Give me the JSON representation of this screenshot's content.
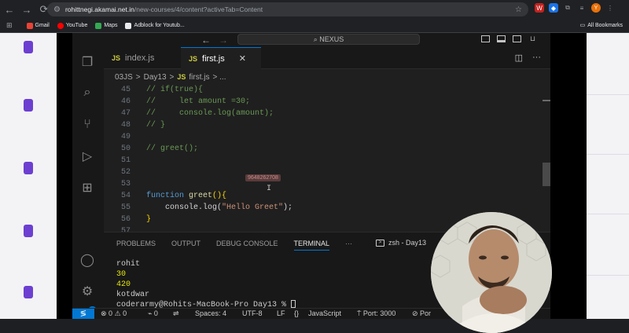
{
  "browser": {
    "url_host": "rohittnegi.akamai.net.in",
    "url_path": "/new-courses/4/content?activeTab=Content",
    "bookmarks": [
      "Gmail",
      "YouTube",
      "Maps",
      "Adblock for Youtub..."
    ],
    "all_bookmarks": "All Bookmarks",
    "profile_initial": "Y",
    "ext_label": "W"
  },
  "vscode": {
    "search_text": "NEXUS",
    "tabs": [
      {
        "badge": "JS",
        "label": "index.js"
      },
      {
        "badge": "JS",
        "label": "first.js",
        "close": "✕"
      }
    ],
    "breadcrumb": {
      "folder1": "03JS",
      "sep": ">",
      "folder2": "Day13",
      "badge": "JS",
      "file": "first.js",
      "tail": "> ..."
    },
    "code_lines": [
      {
        "n": "45",
        "text": "// if(true){"
      },
      {
        "n": "46",
        "text": "//     let amount =30;"
      },
      {
        "n": "47",
        "text": "//     console.log(amount);"
      },
      {
        "n": "48",
        "text": "// }"
      },
      {
        "n": "49",
        "text": ""
      },
      {
        "n": "50",
        "text": "// greet();"
      },
      {
        "n": "51",
        "text": ""
      },
      {
        "n": "52",
        "text": ""
      },
      {
        "n": "53",
        "text": ""
      },
      {
        "n": "54",
        "kw": "function",
        "fn": "greet",
        "tail": "(){"
      },
      {
        "n": "55",
        "call": "console.log(",
        "str": "\"Hello Greet\"",
        "tail": ");"
      },
      {
        "n": "56",
        "tail": "}"
      },
      {
        "n": "57",
        "text": ""
      }
    ],
    "hover_tooltip": "9648262708",
    "panel_tabs": [
      "PROBLEMS",
      "OUTPUT",
      "DEBUG CONSOLE",
      "TERMINAL",
      "···"
    ],
    "terminal_name": "zsh - Day13",
    "terminal_lines": [
      "rohit",
      "30",
      "420",
      "kotdwar"
    ],
    "prompt": "coderarmy@Rohits-MacBook-Pro Day13 % ",
    "activity_badge": "1",
    "status": {
      "errors": "0",
      "warnings": "0",
      "ports": "0",
      "spaces": "Spaces: 4",
      "encoding": "UTF-8",
      "eol": "LF",
      "language": "JavaScript",
      "port": "Port: 3000",
      "port_tail": "Por"
    }
  }
}
